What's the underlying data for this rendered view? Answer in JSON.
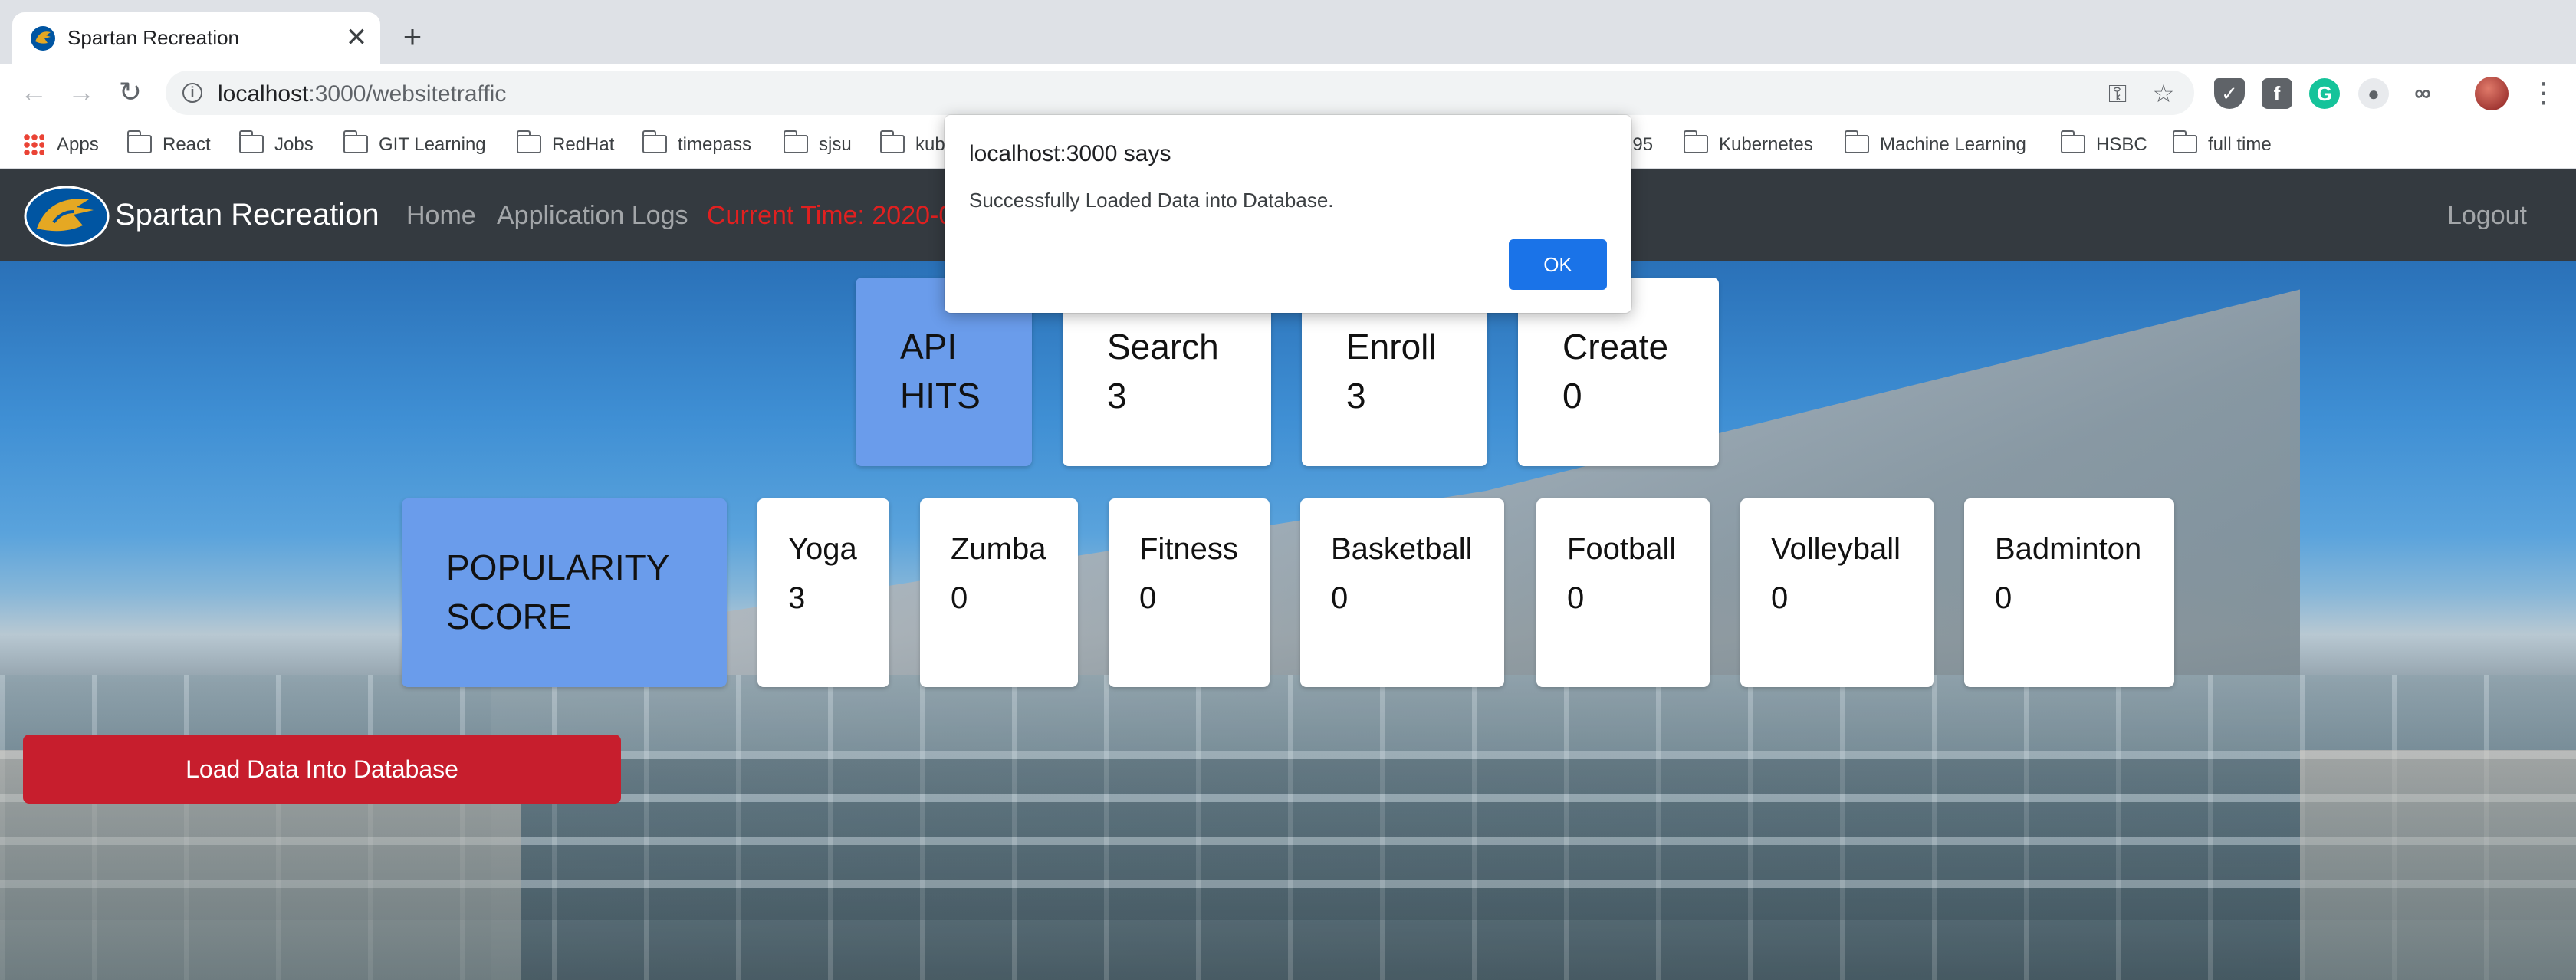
{
  "browser": {
    "tab_title": "Spartan Recreation",
    "tab_close": "✕",
    "new_tab": "+",
    "url_host": "localhost",
    "url_path": ":3000/websitetraffic"
  },
  "bookmarks": [
    {
      "label": "Apps",
      "icon": "apps-grid-icon"
    },
    {
      "label": "React",
      "icon": "folder-icon"
    },
    {
      "label": "Jobs",
      "icon": "folder-icon"
    },
    {
      "label": "GIT Learning",
      "icon": "folder-icon"
    },
    {
      "label": "RedHat",
      "icon": "folder-icon"
    },
    {
      "label": "timepass",
      "icon": "folder-icon"
    },
    {
      "label": "sjsu",
      "icon": "folder-icon"
    },
    {
      "label": "kub",
      "icon": "folder-icon"
    },
    {
      "label": "295",
      "icon": "folder-icon"
    },
    {
      "label": "Kubernetes",
      "icon": "folder-icon"
    },
    {
      "label": "Machine Learning",
      "icon": "folder-icon"
    },
    {
      "label": "HSBC",
      "icon": "folder-icon"
    },
    {
      "label": "full time",
      "icon": "folder-icon"
    }
  ],
  "site": {
    "brand": "Spartan Recreation",
    "nav": [
      "Home",
      "Application Logs"
    ],
    "current_time": "Current Time: 2020-0",
    "logout": "Logout"
  },
  "api_hits": {
    "title": [
      "API",
      "HITS"
    ],
    "cards": [
      {
        "label": "Search",
        "value": "3"
      },
      {
        "label": "Enroll",
        "value": "3"
      },
      {
        "label": "Create",
        "value": "0"
      }
    ]
  },
  "popularity": {
    "title": [
      "POPULARITY",
      "SCORE"
    ],
    "cards": [
      {
        "label": "Yoga",
        "value": "3"
      },
      {
        "label": "Zumba",
        "value": "0"
      },
      {
        "label": "Fitness",
        "value": "0"
      },
      {
        "label": "Basketball",
        "value": "0"
      },
      {
        "label": "Football",
        "value": "0"
      },
      {
        "label": "Volleyball",
        "value": "0"
      },
      {
        "label": "Badminton",
        "value": "0"
      }
    ]
  },
  "load_button": "Load Data Into Database",
  "dialog": {
    "title": "localhost:3000 says",
    "message": "Successfully Loaded Data into Database.",
    "ok": "OK"
  },
  "colors": {
    "navbar": "#343a40",
    "accent_blue": "#6a9ceb",
    "button_red": "#c71e2d",
    "time_red": "#e02020",
    "dialog_ok": "#1a73e8"
  }
}
